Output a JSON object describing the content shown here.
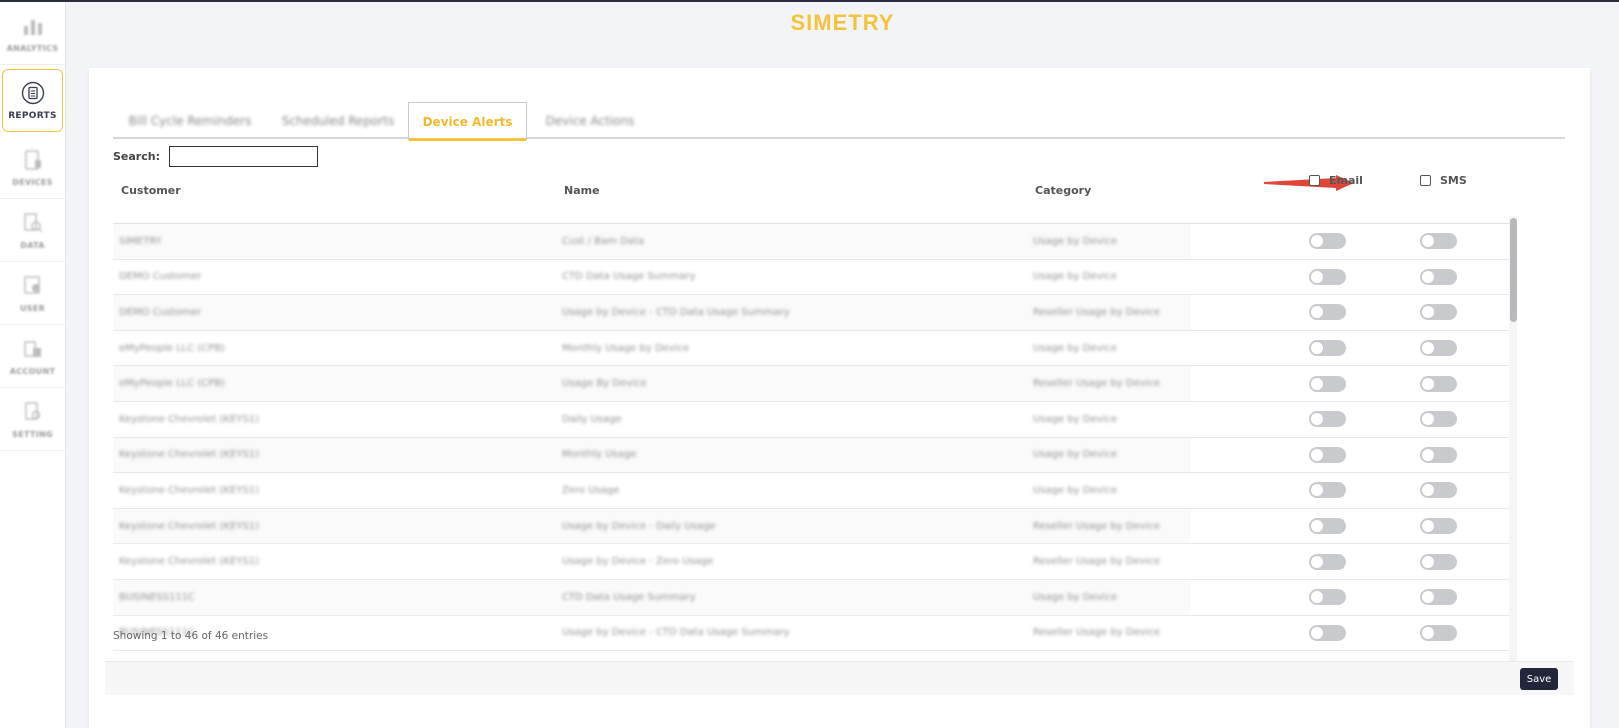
{
  "brand": "SIMETRY",
  "sidebar": {
    "items": [
      {
        "label": "ANALYTICS",
        "icon": "bar-chart-icon"
      },
      {
        "label": "REPORTS",
        "icon": "clipboard-icon"
      },
      {
        "label": "DEVICES",
        "icon": "device-icon"
      },
      {
        "label": "DATA",
        "icon": "data-icon"
      },
      {
        "label": "USER",
        "icon": "user-icon"
      },
      {
        "label": "ACCOUNT",
        "icon": "account-icon"
      },
      {
        "label": "SETTING",
        "icon": "setting-icon"
      }
    ]
  },
  "tabs": [
    {
      "label": "Bill Cycle Reminders"
    },
    {
      "label": "Scheduled Reports"
    },
    {
      "label": "Device Alerts"
    },
    {
      "label": "Device Actions"
    }
  ],
  "search": {
    "label": "Search:",
    "value": ""
  },
  "table": {
    "headers": {
      "customer": "Customer",
      "name": "Name",
      "category": "Category",
      "email": "Email",
      "sms": "SMS"
    },
    "rows": [
      {
        "customer": "SIMETRY",
        "name": "Cust / Bam Data",
        "category": "Usage by Device"
      },
      {
        "customer": "DEMO Customer",
        "name": "CTD Data Usage Summary",
        "category": "Usage by Device"
      },
      {
        "customer": "DEMO Customer",
        "name": "Usage by Device - CTD Data Usage Summary",
        "category": "Reseller Usage by Device"
      },
      {
        "customer": "eMyPeople LLC (CPB)",
        "name": "Monthly Usage by Device",
        "category": "Usage by Device"
      },
      {
        "customer": "eMyPeople LLC (CPB)",
        "name": "Usage By Device",
        "category": "Reseller Usage by Device"
      },
      {
        "customer": "Keystone Chevrolet (KEYS1)",
        "name": "Daily Usage",
        "category": "Usage by Device"
      },
      {
        "customer": "Keystone Chevrolet (KEYS1)",
        "name": "Monthly Usage",
        "category": "Usage by Device"
      },
      {
        "customer": "Keystone Chevrolet (KEYS1)",
        "name": "Zero Usage",
        "category": "Usage by Device"
      },
      {
        "customer": "Keystone Chevrolet (KEYS1)",
        "name": "Usage by Device - Daily Usage",
        "category": "Reseller Usage by Device"
      },
      {
        "customer": "Keystone Chevrolet (KEYS1)",
        "name": "Usage by Device - Zero Usage",
        "category": "Reseller Usage by Device"
      },
      {
        "customer": "BUSINESS111C",
        "name": "CTD Data Usage Summary",
        "category": "Usage by Device"
      },
      {
        "customer": "BUSINESS111C",
        "name": "Usage by Device - CTD Data Usage Summary",
        "category": "Reseller Usage by Device"
      }
    ]
  },
  "entries_text": "Showing 1 to 46 of 46 entries",
  "save_label": "Save",
  "colors": {
    "brand": "#f5c33b",
    "active_tab": "#f5b82e",
    "save_button": "#23263a",
    "annotation_arrow": "#e0453a"
  }
}
